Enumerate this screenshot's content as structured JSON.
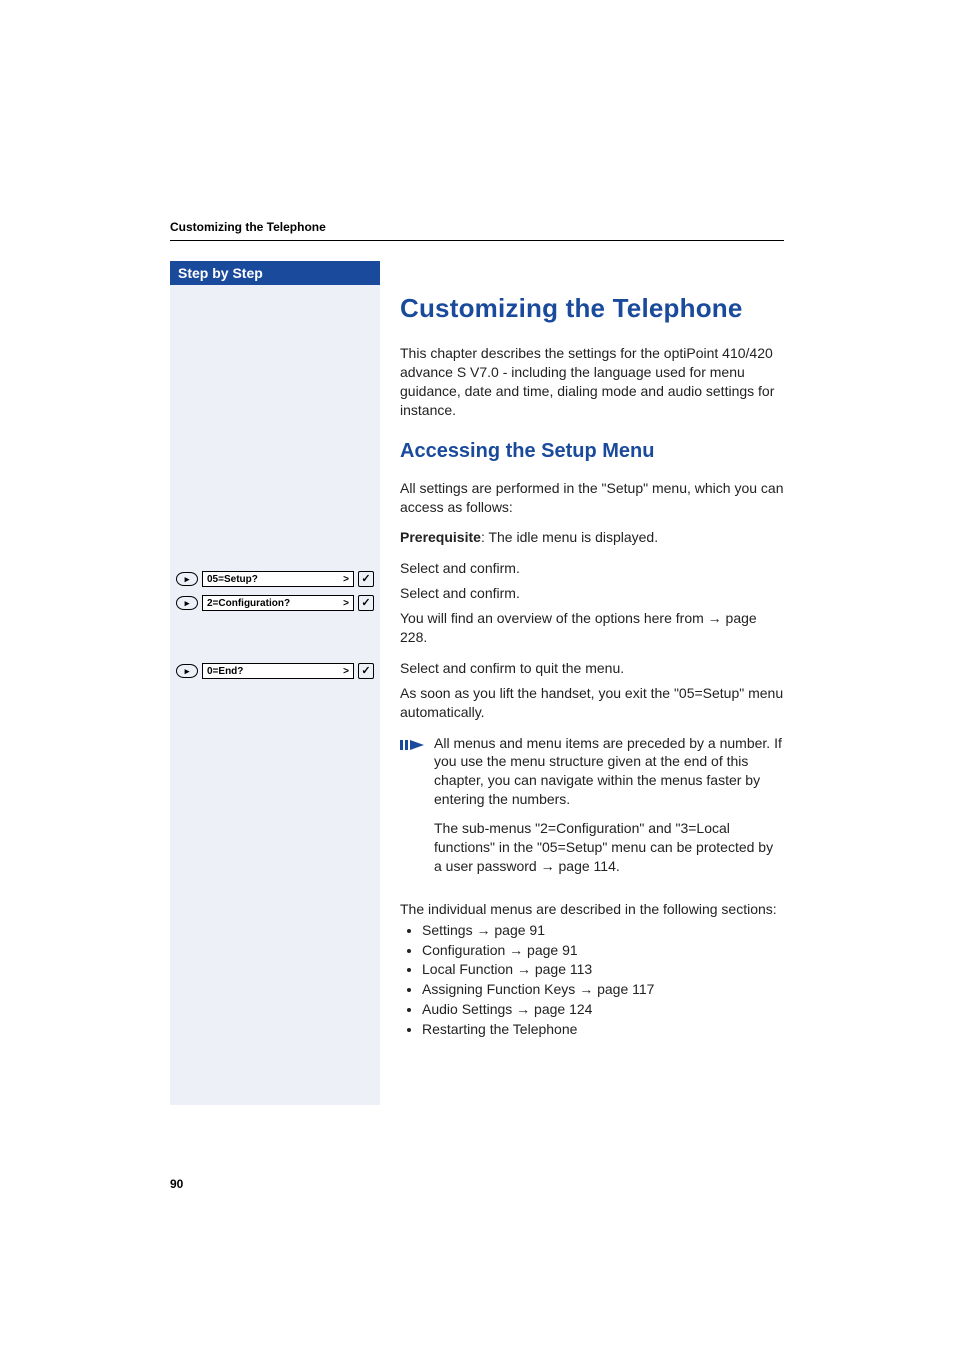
{
  "running_header": "Customizing the Telephone",
  "sidebar": {
    "header": "Step by Step",
    "steps": [
      {
        "nav_glyph": "▸",
        "label": "05=Setup?",
        "gt": ">",
        "confirm": "✓"
      },
      {
        "nav_glyph": "▸",
        "label": "2=Configuration?",
        "gt": ">",
        "confirm": "✓"
      },
      {
        "nav_glyph": "▸",
        "label": "0=End?",
        "gt": ">",
        "confirm": "✓"
      }
    ]
  },
  "content": {
    "title": "Customizing the Telephone",
    "intro": "This chapter describes the settings for the optiPoint 410/420 advance S V7.0 - including the language used for menu guidance, date and time, dialing mode and audio settings for instance.",
    "subtitle": "Accessing the Setup Menu",
    "p_access": "All settings are performed in the \"Setup\" menu, which you can access as follows:",
    "prereq_label": "Prerequisite",
    "prereq_text": ": The idle menu is displayed.",
    "step1_text": "Select and confirm.",
    "step2_text": "Select and confirm.",
    "overview_text_a": "You will find an overview of the options here from ",
    "overview_arrow": "→",
    "overview_text_b": " page 228.",
    "step3_text": "Select and confirm to quit the menu.",
    "exit_text": "As soon as you lift the handset, you exit the \"05=Setup\" menu automatically.",
    "callout": {
      "p1": "All menus and menu items are preceded by a number. If you use the menu structure given at the end of this chapter, you can navigate within the menus faster by entering the numbers.",
      "p2_a": "The sub-menus \"2=Configuration\" and \"3=Local functions\" in the \"05=Setup\" menu can be protected by a user password ",
      "p2_arrow": "→",
      "p2_b": " page 114."
    },
    "sections_intro": "The individual menus are described in the following sections:",
    "bullets": [
      {
        "text_a": "Settings ",
        "arrow": "→",
        "text_b": " page 91"
      },
      {
        "text_a": "Configuration ",
        "arrow": "→",
        "text_b": " page 91"
      },
      {
        "text_a": "Local Function ",
        "arrow": "→",
        "text_b": " page 113"
      },
      {
        "text_a": "Assigning Function Keys ",
        "arrow": "→",
        "text_b": " page 117"
      },
      {
        "text_a": "Audio Settings ",
        "arrow": "→",
        "text_b": " page 124"
      },
      {
        "text_a": "Restarting the Telephone",
        "arrow": "",
        "text_b": ""
      }
    ]
  },
  "page_number": "90"
}
